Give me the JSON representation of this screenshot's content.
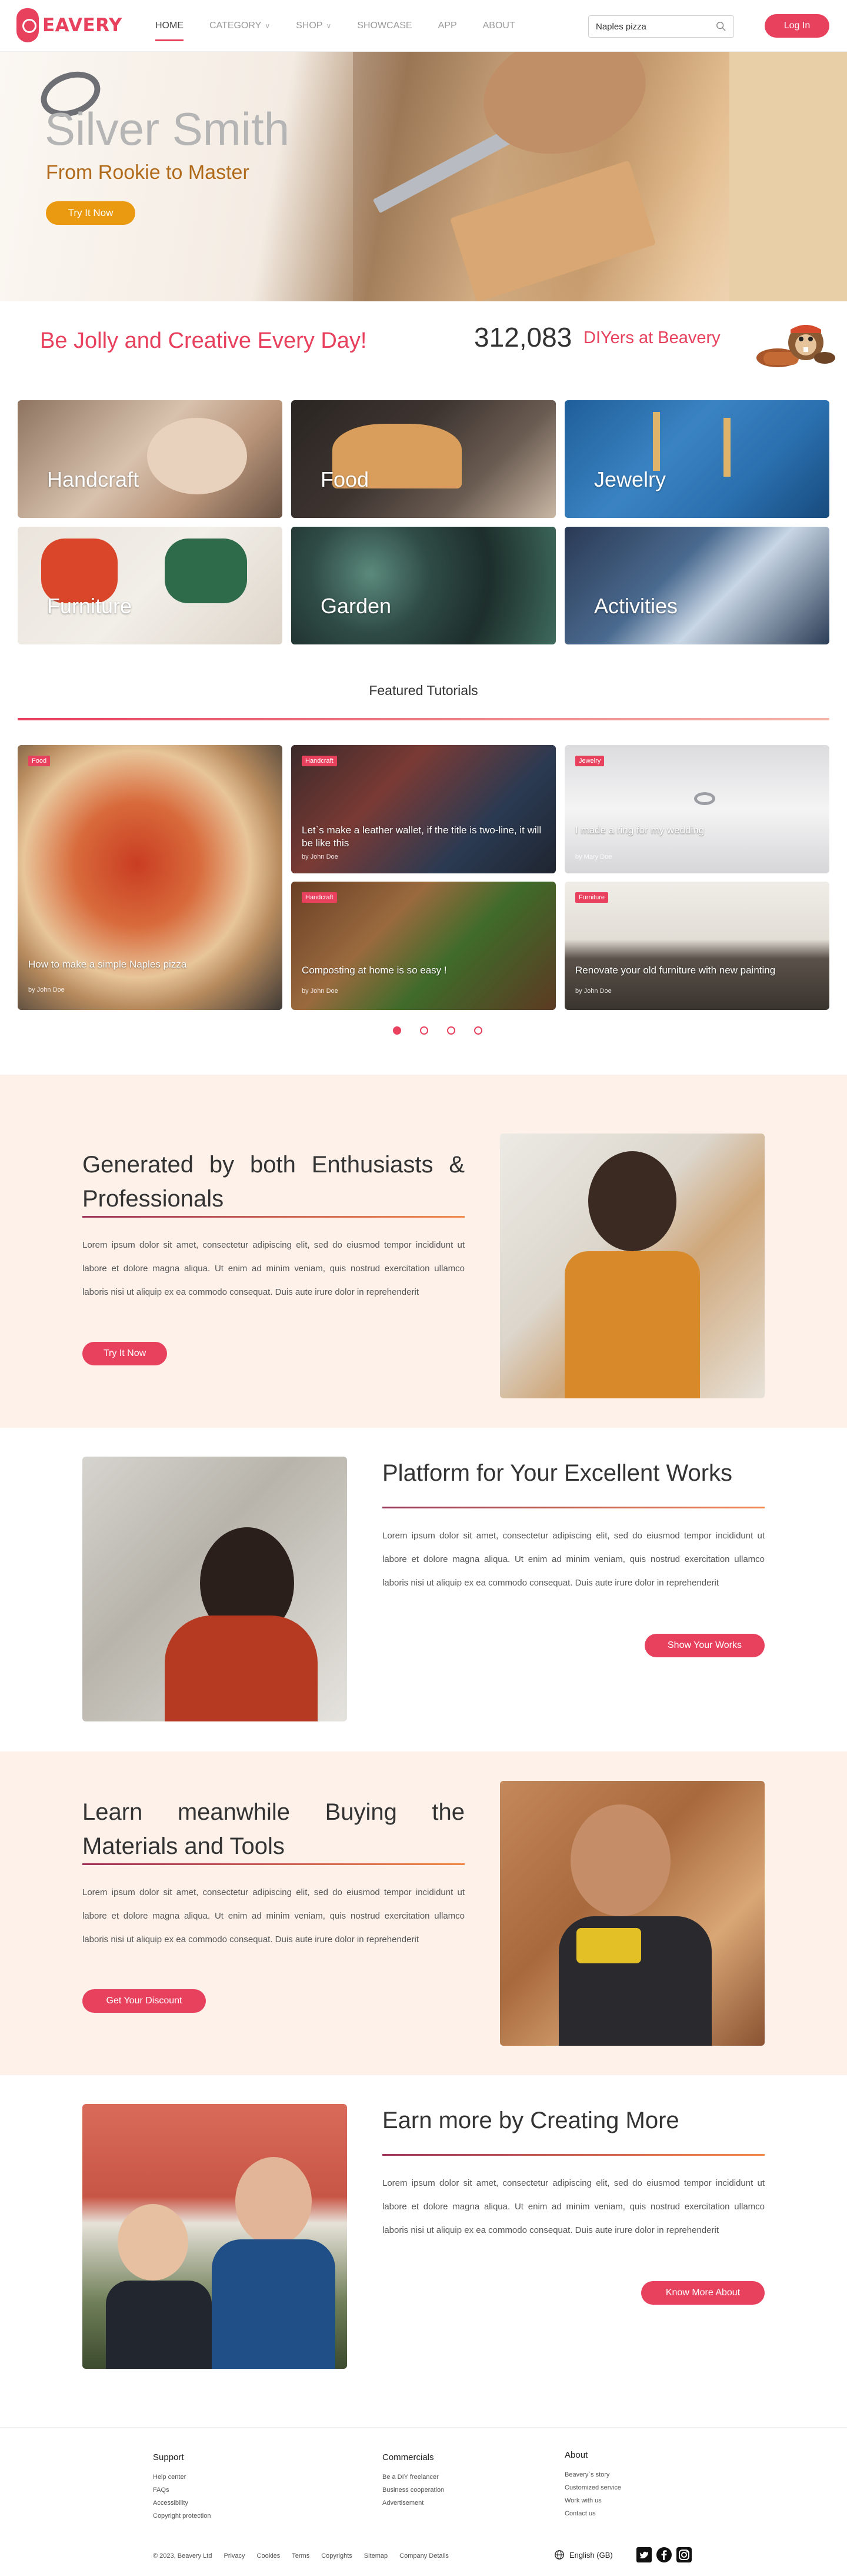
{
  "nav": {
    "logo_text": "EAVERY",
    "items": [
      {
        "label": "HOME",
        "active": true
      },
      {
        "label": "CATEGORY",
        "dropdown": true
      },
      {
        "label": "SHOP",
        "dropdown": true
      },
      {
        "label": "SHOWCASE"
      },
      {
        "label": "APP"
      },
      {
        "label": "ABOUT"
      }
    ],
    "search_value": "Naples pizza",
    "search_icon": "search-icon",
    "login_label": "Log In"
  },
  "hero": {
    "title": "Silver Smith",
    "subtitle": "From Rookie to Master",
    "cta": "Try It Now",
    "slides": 3,
    "active_slide": 0
  },
  "stats": {
    "slogan": "Be Jolly and Creative Every Day!",
    "count": "312,083",
    "count_label": "DIYers at Beavery"
  },
  "categories": [
    {
      "label": "Handcraft"
    },
    {
      "label": "Food"
    },
    {
      "label": "Jewelry"
    },
    {
      "label": "Furniture"
    },
    {
      "label": "Garden"
    },
    {
      "label": "Activities"
    }
  ],
  "featured": {
    "title": "Featured Tutorials",
    "cards": [
      {
        "tag": "Food",
        "title": "How to make a simple Naples pizza",
        "author": "by John Doe"
      },
      {
        "tag": "Handcraft",
        "title": "Let`s make a leather wallet, if the title is two-line, it will be like this",
        "author": "by John Doe"
      },
      {
        "tag": "Jewelry",
        "title": "I made a ring for my wedding",
        "author": "by Mary Doe"
      },
      {
        "tag": "Handcraft",
        "title": "Composting at home is so easy !",
        "author": "by John Doe"
      },
      {
        "tag": "Furniture",
        "title": "Renovate your old furniture with new painting",
        "author": "by John Doe"
      }
    ],
    "pages": 4,
    "active_page": 0
  },
  "sections": [
    {
      "title": "Generated by both Enthusiasts & Professionals",
      "text": "Lorem ipsum dolor sit amet, consectetur adipiscing elit, sed do eiusmod tempor incididunt ut labore et dolore magna aliqua. Ut enim ad minim veniam, quis nostrud exercitation ullamco laboris nisi ut aliquip ex ea commodo consequat. Duis aute irure dolor in reprehenderit",
      "button": "Try It Now"
    },
    {
      "title": "Platform for Your Excellent Works",
      "text": "Lorem ipsum dolor sit amet, consectetur adipiscing elit, sed do eiusmod tempor incididunt ut labore et dolore magna aliqua. Ut enim ad minim veniam, quis nostrud exercitation ullamco laboris nisi ut aliquip ex ea commodo consequat. Duis aute irure dolor in reprehenderit",
      "button": "Show Your Works"
    },
    {
      "title": "Learn meanwhile Buying the Materials and Tools",
      "text": "Lorem ipsum dolor sit amet, consectetur adipiscing elit, sed do eiusmod tempor incididunt ut labore et dolore magna aliqua. Ut enim ad minim veniam, quis nostrud exercitation ullamco laboris nisi ut aliquip ex ea commodo consequat. Duis aute irure dolor in reprehenderit",
      "button": "Get Your Discount"
    },
    {
      "title": "Earn more by Creating More",
      "text": "Lorem ipsum dolor sit amet, consectetur adipiscing elit, sed do eiusmod tempor incididunt ut labore et dolore magna aliqua. Ut enim ad minim veniam, quis nostrud exercitation ullamco laboris nisi ut aliquip ex ea commodo consequat. Duis aute irure dolor in reprehenderit",
      "button": "Know More About"
    }
  ],
  "footer": {
    "support": {
      "title": "Support",
      "links": [
        "Help center",
        "FAQs",
        "Accessibility",
        "Copyright protection"
      ]
    },
    "commercials": {
      "title": "Commercials",
      "links": [
        "Be a DIY freelancer",
        "Business cooperation",
        "Advertisement"
      ]
    },
    "about": {
      "title": "About",
      "links": [
        "Beavery`s story",
        "Customized service",
        "Work with us",
        "Contact us"
      ]
    },
    "bottom": [
      "© 2023, Beavery Ltd",
      "Privacy",
      "Cookies",
      "Terms",
      "Copyrights",
      "Sitemap",
      "Company Details"
    ],
    "language": "English (GB)",
    "social": [
      "twitter-icon",
      "facebook-icon",
      "instagram-icon"
    ]
  },
  "colors": {
    "accent": "#e8415e",
    "orange": "#ea9a10",
    "band": "#fdf1ea"
  }
}
